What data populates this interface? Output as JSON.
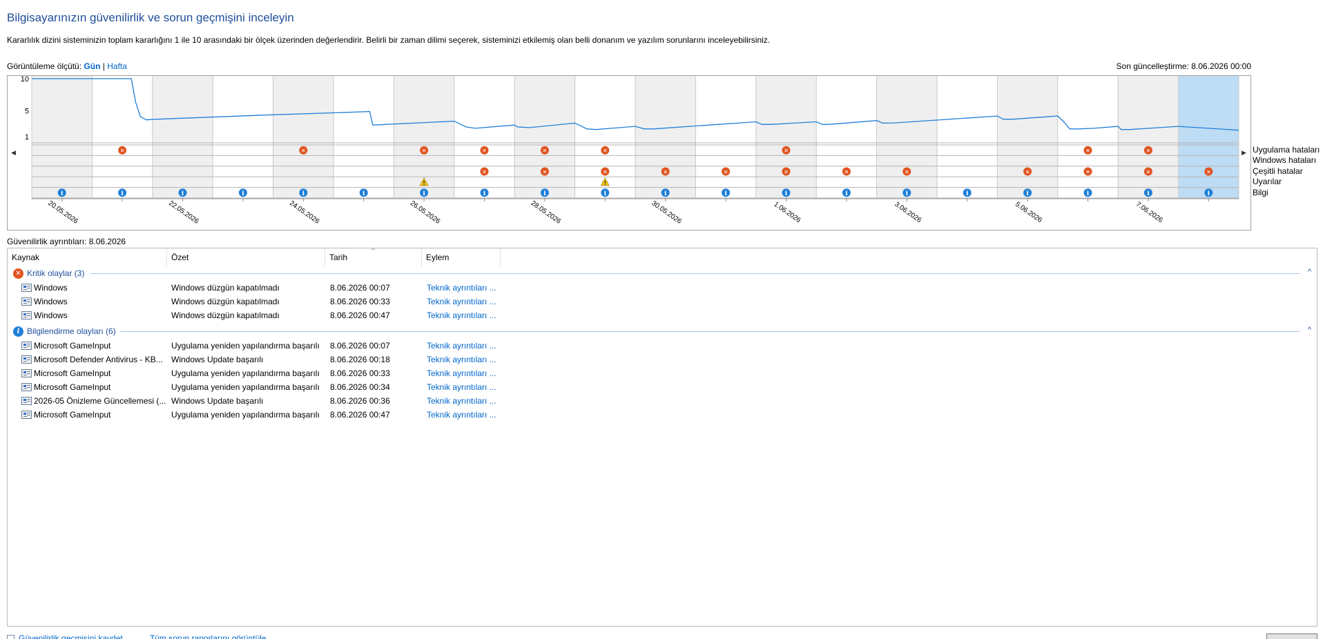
{
  "header": {
    "title": "Bilgisayarınızın güvenilirlik ve sorun geçmişini inceleyin",
    "description": "Kararlılık dizini sisteminizin toplam kararlığını 1 ile 10 arasındaki bir ölçek üzerinden değerlendirir. Belirli bir zaman dilimi seçerek, sisteminizi etkilemiş olan belli donanım ve yazılım sorunlarını inceleyebilirsiniz.",
    "view_by_label": "Görüntüleme ölçütü:",
    "view_day": "Gün",
    "view_separator": "|",
    "view_week": "Hafta",
    "last_updated": "Son güncelleştirme: 8.06.2026 00:00"
  },
  "chart_data": {
    "type": "line",
    "y_ticks": [
      "10",
      "5",
      "1"
    ],
    "ylim": [
      1,
      10
    ],
    "x_labels": [
      "20.05.2026",
      "22.05.2026",
      "24.05.2026",
      "26.05.2026",
      "28.05.2026",
      "30.05.2026",
      "1.06.2026",
      "3.06.2026",
      "5.06.2026",
      "7.06.2026"
    ],
    "days": [
      "20.05.2026",
      "21.05.2026",
      "22.05.2026",
      "23.05.2026",
      "24.05.2026",
      "25.05.2026",
      "26.05.2026",
      "27.05.2026",
      "28.05.2026",
      "29.05.2026",
      "30.05.2026",
      "31.05.2026",
      "1.06.2026",
      "2.06.2026",
      "3.06.2026",
      "4.06.2026",
      "5.06.2026",
      "6.06.2026",
      "7.06.2026",
      "8.06.2026"
    ],
    "stability_index": [
      [
        0.0,
        10.0
      ],
      [
        1.65,
        10.0
      ],
      [
        1.72,
        6.4
      ],
      [
        1.8,
        4.1
      ],
      [
        1.9,
        3.6
      ],
      [
        2.05,
        3.7
      ],
      [
        4.0,
        4.4
      ],
      [
        5.0,
        4.7
      ],
      [
        5.6,
        4.9
      ],
      [
        5.65,
        2.8
      ],
      [
        7.0,
        3.4
      ],
      [
        7.2,
        2.5
      ],
      [
        7.35,
        2.3
      ],
      [
        8.0,
        2.8
      ],
      [
        8.05,
        2.5
      ],
      [
        8.25,
        2.4
      ],
      [
        9.0,
        3.1
      ],
      [
        9.2,
        2.2
      ],
      [
        9.35,
        2.1
      ],
      [
        10.0,
        2.6
      ],
      [
        10.15,
        2.2
      ],
      [
        10.3,
        2.2
      ],
      [
        12.0,
        3.3
      ],
      [
        12.1,
        2.9
      ],
      [
        12.25,
        2.9
      ],
      [
        13.0,
        3.3
      ],
      [
        13.1,
        2.9
      ],
      [
        13.2,
        2.9
      ],
      [
        14.0,
        3.5
      ],
      [
        14.1,
        3.1
      ],
      [
        14.25,
        3.1
      ],
      [
        16.0,
        4.2
      ],
      [
        16.1,
        3.7
      ],
      [
        16.25,
        3.7
      ],
      [
        17.0,
        4.2
      ],
      [
        17.1,
        3.3
      ],
      [
        17.2,
        2.2
      ],
      [
        17.35,
        2.2
      ],
      [
        17.6,
        2.3
      ],
      [
        18.0,
        2.6
      ],
      [
        18.05,
        2.1
      ],
      [
        18.2,
        2.1
      ],
      [
        19.0,
        2.6
      ],
      [
        20.0,
        2.0
      ]
    ],
    "rows": [
      "Uygulama hataları",
      "Windows hataları",
      "Çeşitli hatalar",
      "Uyarılar",
      "Bilgi"
    ],
    "events": {
      "Uygulama hataları": [
        1,
        4,
        6,
        7,
        8,
        9,
        12,
        17,
        18
      ],
      "Windows hataları": [],
      "Çeşitli hatalar": [
        7,
        8,
        9,
        10,
        11,
        12,
        13,
        14,
        16,
        17,
        18,
        19
      ],
      "Uyarılar": [
        6,
        9
      ],
      "Bilgi": [
        0,
        1,
        2,
        3,
        4,
        5,
        6,
        7,
        8,
        9,
        10,
        11,
        12,
        13,
        14,
        15,
        16,
        17,
        18,
        19
      ]
    },
    "selected_day": "8.06.2026",
    "colors": {
      "line": "#1e7fd8",
      "selected": "#bfdcf5",
      "shade": "#efefef",
      "critical": "#e0541f",
      "warning": "#f5c518",
      "info": "#1e7fd8"
    }
  },
  "details": {
    "caption": "Güvenilirlik ayrıntıları: 8.06.2026",
    "columns": [
      "Kaynak",
      "Özet",
      "Tarih",
      "Eylem"
    ],
    "sort_indicator": "^",
    "groups": [
      {
        "label": "Kritik olaylar (3)",
        "icon": "critical-icon",
        "collapse": "^",
        "rows": [
          {
            "source": "Windows",
            "summary": "Windows düzgün kapatılmadı",
            "date": "8.06.2026 00:07",
            "action": "Teknik ayrıntıları ..."
          },
          {
            "source": "Windows",
            "summary": "Windows düzgün kapatılmadı",
            "date": "8.06.2026 00:33",
            "action": "Teknik ayrıntıları ..."
          },
          {
            "source": "Windows",
            "summary": "Windows düzgün kapatılmadı",
            "date": "8.06.2026 00:47",
            "action": "Teknik ayrıntıları ..."
          }
        ]
      },
      {
        "label": "Bilgilendirme olayları (6)",
        "icon": "info-icon",
        "collapse": "^",
        "rows": [
          {
            "source": "Microsoft GameInput",
            "summary": "Uygulama yeniden yapılandırma başarılı",
            "date": "8.06.2026 00:07",
            "action": "Teknik ayrıntıları ..."
          },
          {
            "source": "Microsoft Defender Antivirus - KB...",
            "summary": "Windows Update başarılı",
            "date": "8.06.2026 00:18",
            "action": "Teknik ayrıntıları ..."
          },
          {
            "source": "Microsoft GameInput",
            "summary": "Uygulama yeniden yapılandırma başarılı",
            "date": "8.06.2026 00:33",
            "action": "Teknik ayrıntıları ..."
          },
          {
            "source": "Microsoft GameInput",
            "summary": "Uygulama yeniden yapılandırma başarılı",
            "date": "8.06.2026 00:34",
            "action": "Teknik ayrıntıları ..."
          },
          {
            "source": "2026-05 Önizleme Güncellemesi (...",
            "summary": "Windows Update başarılı",
            "date": "8.06.2026 00:36",
            "action": "Teknik ayrıntıları ..."
          },
          {
            "source": "Microsoft GameInput",
            "summary": "Uygulama yeniden yapılandırma başarılı",
            "date": "8.06.2026 00:47",
            "action": "Teknik ayrıntıları ..."
          }
        ]
      }
    ]
  },
  "footer": {
    "save_history": "Güvenilirlik geçmişini kaydet...",
    "view_all_reports": "Tüm sorun raporlarını görüntüle"
  }
}
